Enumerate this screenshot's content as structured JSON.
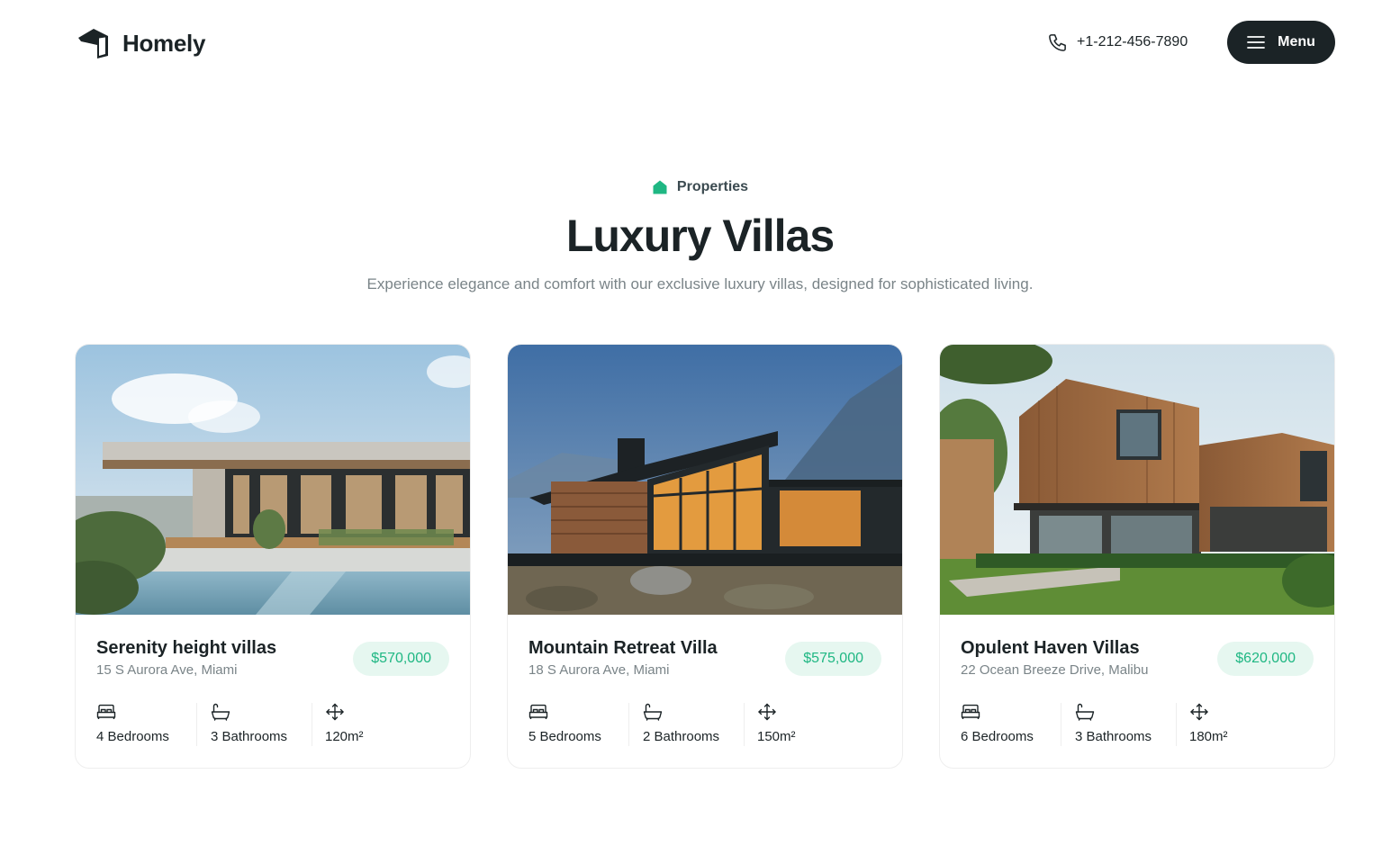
{
  "header": {
    "brand": "Homely",
    "phone": "+1-212-456-7890",
    "menu_label": "Menu"
  },
  "intro": {
    "eyebrow": "Properties",
    "title": "Luxury Villas",
    "subtitle": "Experience elegance and comfort with our exclusive luxury  villas, designed for sophisticated living."
  },
  "cards": [
    {
      "name": "Serenity height villas",
      "address": "15 S Aurora Ave, Miami",
      "price": "$570,000",
      "bedrooms": "4 Bedrooms",
      "bathrooms": "3 Bathrooms",
      "area": "120m²"
    },
    {
      "name": "Mountain Retreat Villa",
      "address": "18 S Aurora Ave, Miami",
      "price": "$575,000",
      "bedrooms": "5 Bedrooms",
      "bathrooms": "2 Bathrooms",
      "area": "150m²"
    },
    {
      "name": "Opulent Haven Villas",
      "address": "22 Ocean Breeze Drive, Malibu",
      "price": "$620,000",
      "bedrooms": "6 Bedrooms",
      "bathrooms": "3 Bathrooms",
      "area": "180m²"
    }
  ],
  "colors": {
    "brand_dark": "#1b2326",
    "accent_green": "#1fb783",
    "price_bg": "#e6f7f0",
    "muted_text": "#7a8488"
  },
  "icons": [
    "logo-icon",
    "phone-icon",
    "hamburger-icon",
    "home-icon",
    "bed-icon",
    "bathtub-icon",
    "area-arrows-icon"
  ]
}
